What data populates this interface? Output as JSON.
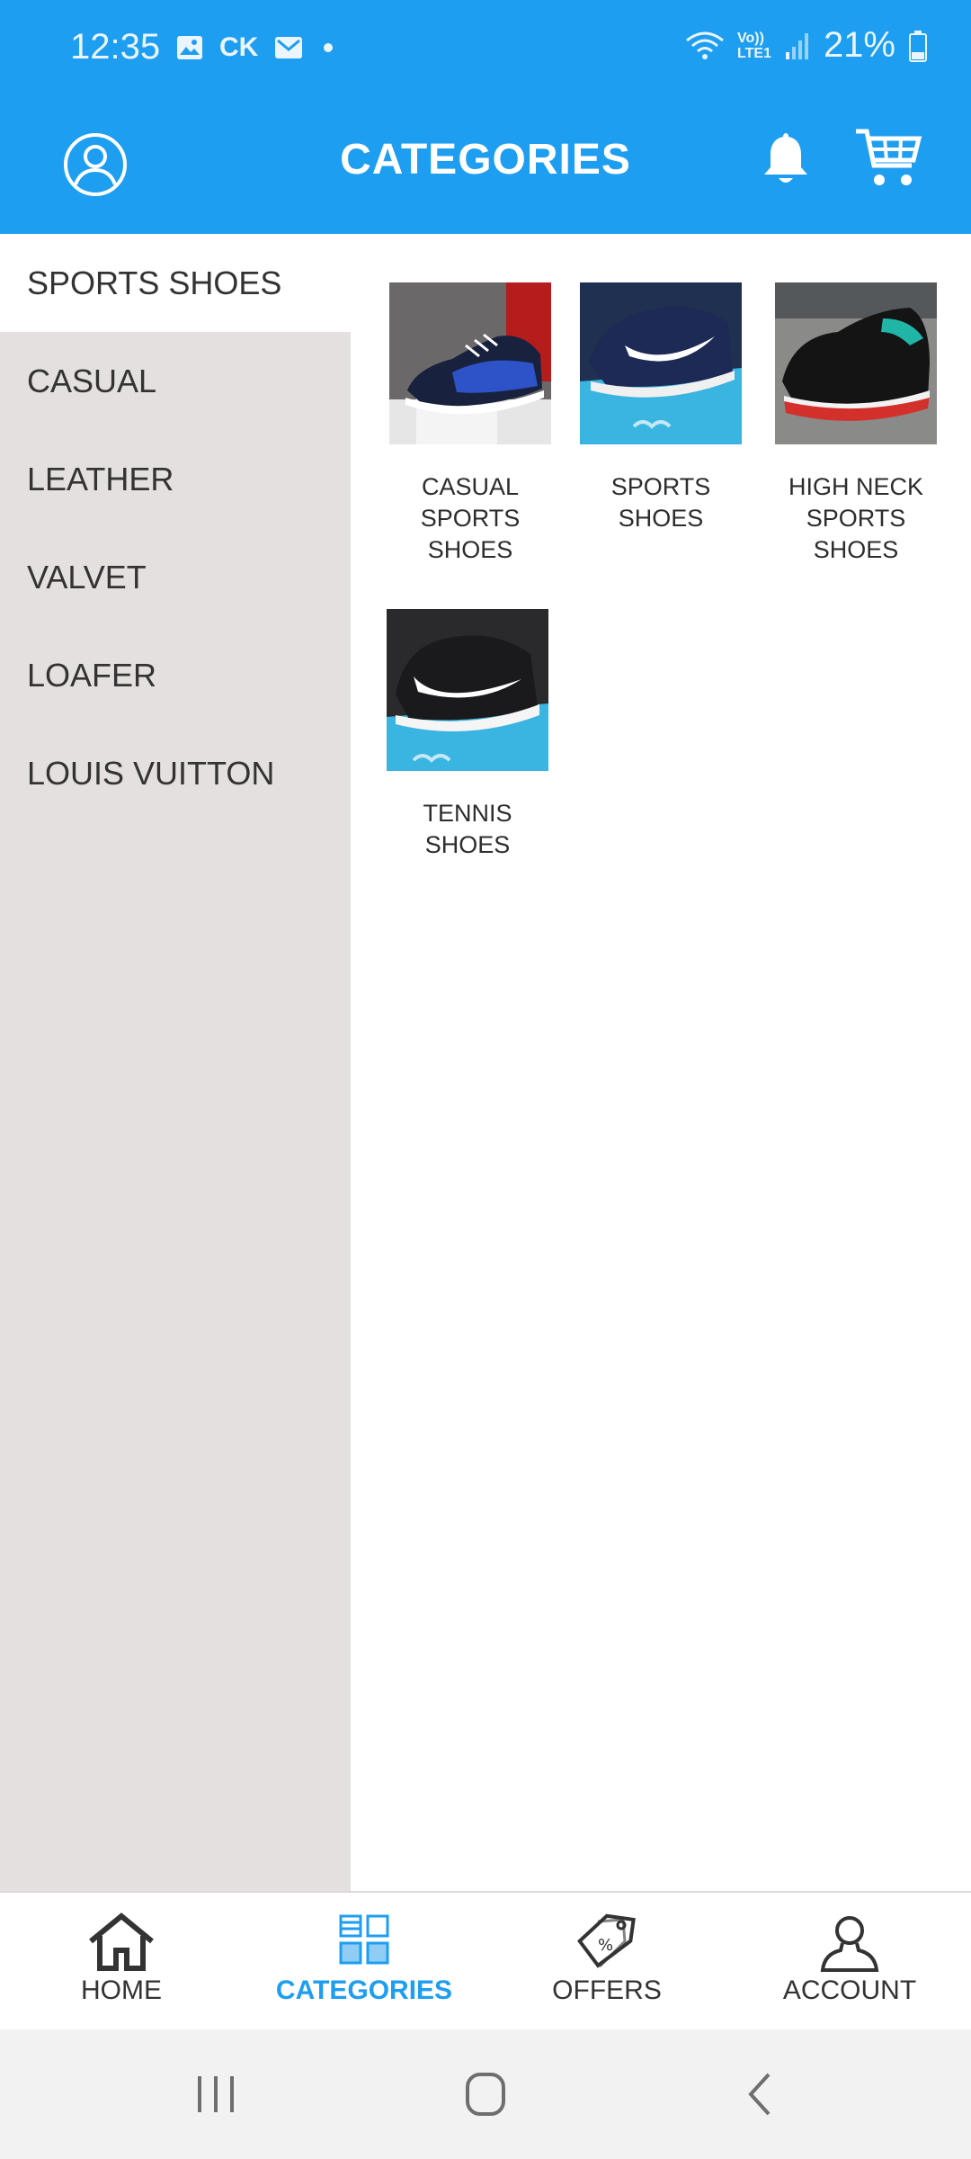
{
  "status_bar": {
    "time": "12:35",
    "carrier_tag": "CK",
    "lte_top": "Vo))",
    "lte_bottom": "LTE1",
    "battery": "21%"
  },
  "app_bar": {
    "title": "CATEGORIES"
  },
  "sidebar": {
    "items": [
      {
        "label": "SPORTS SHOES",
        "active": true
      },
      {
        "label": "CASUAL"
      },
      {
        "label": "LEATHER"
      },
      {
        "label": "VALVET"
      },
      {
        "label": "LOAFER"
      },
      {
        "label": "LOUIS VUITTON"
      }
    ]
  },
  "products": [
    {
      "line1": "CASUAL",
      "line2": "SPORTS",
      "line3": "SHOES"
    },
    {
      "line1": "SPORTS",
      "line2": "SHOES"
    },
    {
      "line1": "HIGH NECK",
      "line2": "SPORTS",
      "line3": "SHOES"
    },
    {
      "line1": "TENNIS",
      "line2": "SHOES"
    }
  ],
  "bottom_nav": {
    "items": [
      {
        "label": "HOME",
        "icon": "home-icon"
      },
      {
        "label": "CATEGORIES",
        "icon": "categories-icon",
        "active": true
      },
      {
        "label": "OFFERS",
        "icon": "offers-tag-icon"
      },
      {
        "label": "ACCOUNT",
        "icon": "account-icon"
      }
    ]
  },
  "colors": {
    "primary": "#1e9ef0",
    "sidebar_bg": "#e3e0df",
    "text": "#333333"
  }
}
